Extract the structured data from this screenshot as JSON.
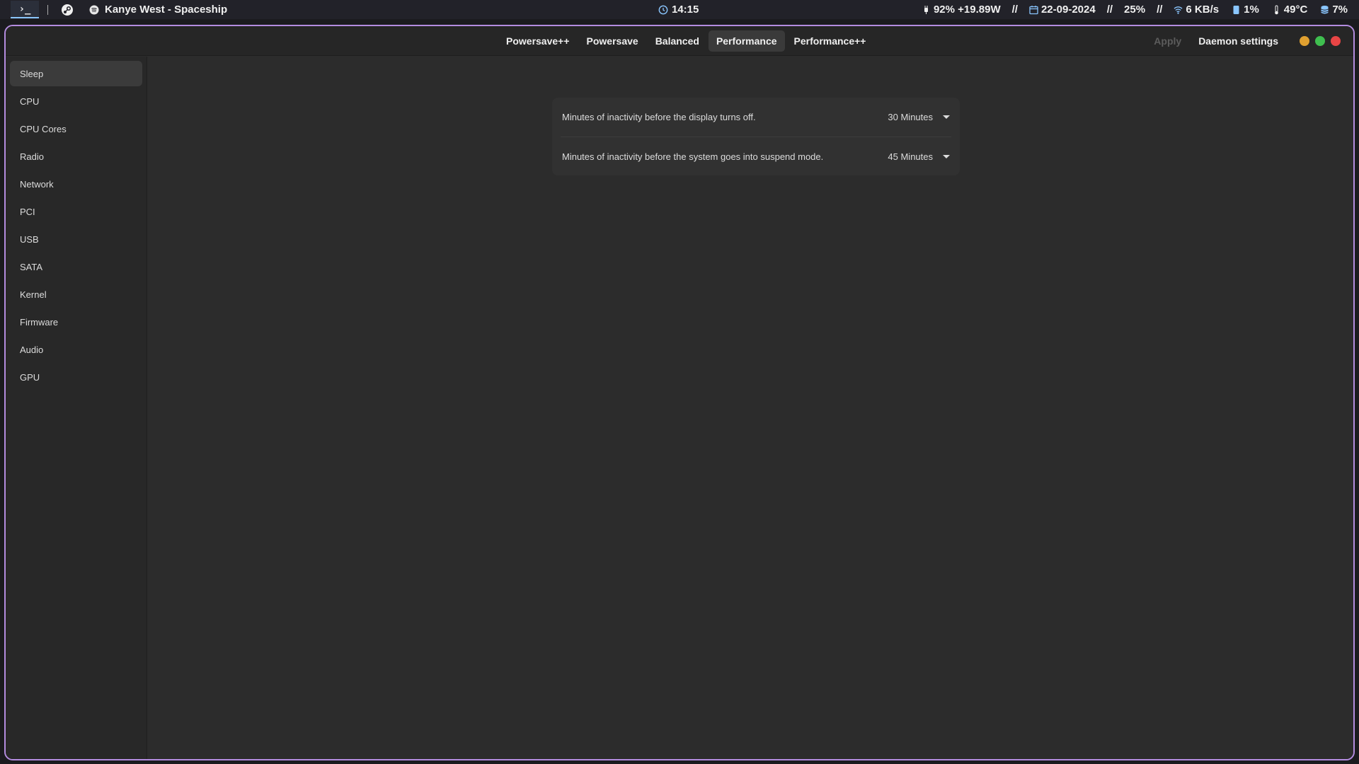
{
  "topbar": {
    "workspace_glyph": "›_",
    "now_playing": "Kanye West - Spaceship",
    "clock": "14:15",
    "battery": "92% +19.89W",
    "separator": "//",
    "date": "22-09-2024",
    "cpu": "25%",
    "network": "6 KB/s",
    "memory": "1%",
    "temperature": "49°C",
    "disk": "7%",
    "accent_color": "#8ac6ff"
  },
  "headerbar": {
    "profiles": [
      "Powersave++",
      "Powersave",
      "Balanced",
      "Performance",
      "Performance++"
    ],
    "active_profile": "Performance",
    "apply_label": "Apply",
    "daemon_settings_label": "Daemon settings"
  },
  "sidebar": {
    "items": [
      "Sleep",
      "CPU",
      "CPU Cores",
      "Radio",
      "Network",
      "PCI",
      "USB",
      "SATA",
      "Kernel",
      "Firmware",
      "Audio",
      "GPU"
    ],
    "active": "Sleep"
  },
  "sleep": {
    "display_off": {
      "label": "Minutes of inactivity before the display turns off.",
      "value": "30 Minutes"
    },
    "suspend": {
      "label": "Minutes of inactivity before the system goes into suspend mode.",
      "value": "45 Minutes"
    }
  },
  "window": {
    "border_color": "#b48ce0",
    "control_colors": {
      "minimize": "#e0a030",
      "maximize": "#3fbf4f",
      "close": "#e84545"
    }
  }
}
